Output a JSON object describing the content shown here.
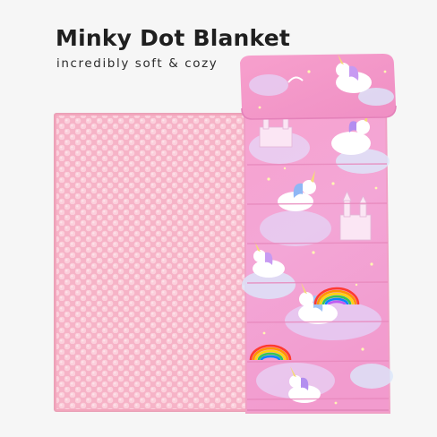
{
  "headline": {
    "title": "Minky Dot Blanket",
    "subtitle": "incredibly soft & cozy"
  },
  "colors": {
    "background": "#f6f6f6",
    "minky_pink": "#f7b8cb",
    "mat_pink": "#f59ecb",
    "mat_lavender": "#e9c3ee",
    "title_text": "#1f1f1f"
  },
  "product": {
    "blanket_icon": "minky-dot-blanket",
    "mat_icon": "unicorn-rainbow-nap-mat",
    "pillow_icon": "nap-mat-pillow"
  }
}
